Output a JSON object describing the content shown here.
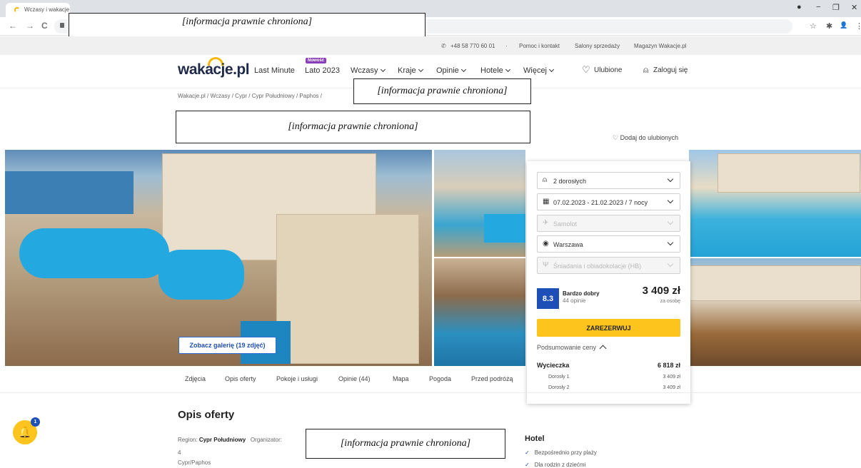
{
  "browser": {
    "tab_title": "Wczasy i wakacje z",
    "window_controls": [
      "●",
      "−",
      "❐",
      "✕"
    ],
    "nav": [
      "←",
      "→",
      "C"
    ],
    "ext_icons": [
      "☆",
      "✱",
      "👤",
      "⋮"
    ]
  },
  "redaction_text": "[informacja prawnie chroniona]",
  "infobar": {
    "phone": "+48 58 770 60 01",
    "dot": "·",
    "help": "Pomoc i kontakt",
    "stores": "Salony sprzedaży",
    "magazine": "Magazyn Wakacje.pl"
  },
  "nav": {
    "logo": "wakacje.pl",
    "last_minute": "Last Minute",
    "new_badge": "Nowość",
    "summer": "Lato 2023",
    "wczasy": "Wczasy",
    "kraje": "Kraje",
    "opinie": "Opinie",
    "hotele": "Hotele",
    "wiecej": "Więcej",
    "favorites": "Ulubione",
    "login": "Zaloguj się"
  },
  "breadcrumb": "Wakacje.pl  /  Wczasy  /  Cypr  /  Cypr Południowy  /  Paphos  /",
  "add_favorite": "Dodaj do ulubionych",
  "gallery_button": "Zobacz galerię (19 zdjęć)",
  "booking": {
    "guests": "2 dorosłych",
    "dates": "07.02.2023 - 21.02.2023 / 7 nocy",
    "transport": "Samolot",
    "departure": "Warszawa",
    "board": "Śniadania i obiadokolacje (HB)",
    "score": "8.3",
    "score_label": "Bardzo dobry",
    "reviews": "44 opinie",
    "price": "3 409 zł",
    "price_note": "za osobę",
    "reserve": "ZAREZERWUJ",
    "summary": "Podsumowanie ceny",
    "trip_label": "Wycieczka",
    "trip_price": "6 818 zł",
    "adult1_label": "Dorosły 1",
    "adult1_price": "3 409 zł",
    "adult2_label": "Dorosły 2",
    "adult2_price": "3 409 zł"
  },
  "tabs": [
    "Zdjęcia",
    "Opis oferty",
    "Pokoje i usługi",
    "Opinie (44)",
    "Mapa",
    "Pogoda",
    "Przed podróżą"
  ],
  "offer": {
    "title": "Opis oferty",
    "region_label": "Region:",
    "region_value": "Cypr Południowy",
    "organizer_label": "Organizator:",
    "stars": "4",
    "place": "Cypr/Paphos",
    "hotel_heading": "Hotel",
    "features": [
      "Bezpośrednio przy plaży",
      "Dla rodzin z dziećmi"
    ]
  },
  "bell_count": "1",
  "colors": {
    "brand_yellow": "#fcc41d",
    "brand_blue": "#1e4fb7",
    "badge_purple": "#8a3fb8"
  }
}
